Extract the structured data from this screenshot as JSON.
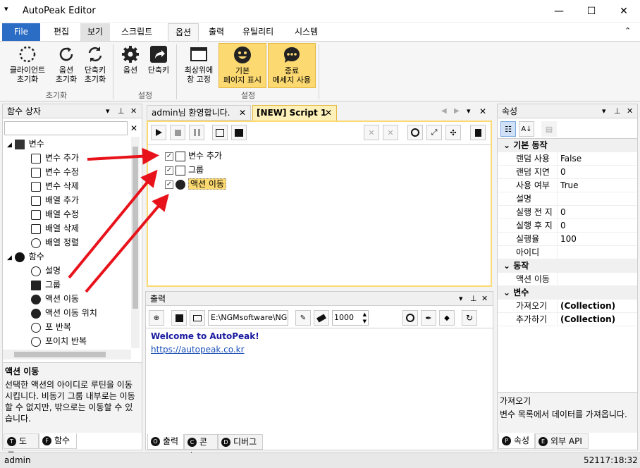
{
  "window": {
    "title": "AutoPeak Editor",
    "quick_menu": "▾",
    "minimize": "—",
    "maximize": "☐",
    "close": "✕"
  },
  "ribbon": {
    "tabs": [
      "File",
      "편집",
      "보기",
      "스크립트",
      "옵션",
      "출력",
      "유틸리티",
      "시스템"
    ],
    "collapse_icon": "⌃",
    "buttons": {
      "client_reset": "클라이언트\n초기화",
      "option_reset": "옵션\n초기화",
      "shortcut_reset": "단축키\n초기화",
      "options": "옵션",
      "shortcuts": "단축키",
      "always_top": "최상위에\n창 고정",
      "default_page": "기본\n페이지 표시",
      "exit_message": "종료\n메세지 사용"
    },
    "groups": {
      "reset": "초기화",
      "settings": "설정",
      "settings2": "설정"
    }
  },
  "function_box": {
    "title": "함수 상자",
    "search_clear": "✕",
    "tree": {
      "variable": "변수",
      "var_items": [
        "변수 추가",
        "변수 수정",
        "변수 삭제",
        "배열 추가",
        "배열 수정",
        "배열 삭제",
        "배열 정렬"
      ],
      "function": "함수",
      "func_items": [
        "설명",
        "그룹",
        "액션 이동",
        "액션 이동 위치",
        "포 반복",
        "포이치 반복"
      ]
    },
    "desc_title": "액션 이동",
    "desc_text": "선택한 액션의 아이디로 루틴을 이동시킵니다. 비동기 그룹 내부로는 이동할 수 없지만, 밖으로는 이동할 수 있습니다.",
    "tabs": {
      "tools": "도구",
      "tools_badge": "T",
      "functions": "함수",
      "functions_badge": "F"
    }
  },
  "documents": {
    "tab1": "admin님 환영합니다.",
    "tab2": "[NEW] Script 1",
    "script_items": [
      "변수 추가",
      "그룹",
      "액션 이동"
    ]
  },
  "output": {
    "title": "출력",
    "path": "E:\\NGMsoftware\\NG",
    "delay": "1000",
    "welcome": "Welcome to AutoPeak!",
    "link": "https://autopeak.co.kr",
    "tabs": {
      "output": "출력",
      "output_badge": "O",
      "console": "콘솔",
      "console_badge": "C",
      "debug": "디버그",
      "debug_badge": "D"
    }
  },
  "properties": {
    "title": "속성",
    "cat_basic": "기본 동작",
    "rows_basic": [
      {
        "k": "랜덤 사용",
        "v": "False"
      },
      {
        "k": "랜덤 지연",
        "v": "0"
      },
      {
        "k": "사용 여부",
        "v": "True"
      },
      {
        "k": "설명",
        "v": ""
      },
      {
        "k": "실행 전 지",
        "v": "0"
      },
      {
        "k": "실행 후 지",
        "v": "0"
      },
      {
        "k": "실행율",
        "v": "100"
      },
      {
        "k": "아이디",
        "v": ""
      }
    ],
    "cat_action": "동작",
    "rows_action": [
      {
        "k": "액션 이동",
        "v": ""
      }
    ],
    "cat_var": "변수",
    "rows_var": [
      {
        "k": "가져오기",
        "v": "(Collection)"
      },
      {
        "k": "추가하기",
        "v": "(Collection)"
      }
    ],
    "desc_title": "가져오기",
    "desc_text": "변수 목록에서 데이터를 가져옵니다.",
    "tabs": {
      "props": "속성",
      "props_badge": "P",
      "api": "외부 API",
      "api_badge": "E"
    }
  },
  "status": {
    "user": "admin",
    "time": "52117:18:32"
  },
  "colors": {
    "accent": "#2b6cc4",
    "highlight": "#fcd971",
    "arrow": "#e8121b",
    "link": "#1a4fb5"
  }
}
